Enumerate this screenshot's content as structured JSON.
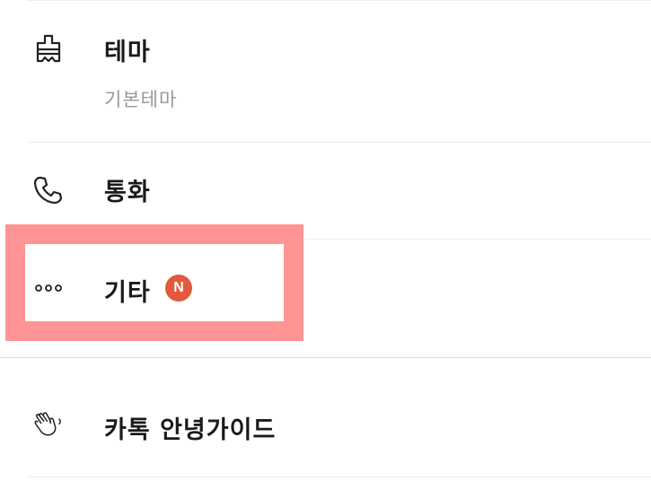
{
  "menu": {
    "theme": {
      "label": "테마",
      "value": "기본테마",
      "icon": "paintbrush-icon"
    },
    "call": {
      "label": "통화",
      "icon": "phone-icon"
    },
    "etc": {
      "label": "기타",
      "icon": "more-dots-icon",
      "badge": "N",
      "badge_color": "#e2593b"
    },
    "guide": {
      "label": "카톡 안녕가이드",
      "icon": "waving-hand-icon"
    }
  },
  "highlight_color": "#ff9494"
}
